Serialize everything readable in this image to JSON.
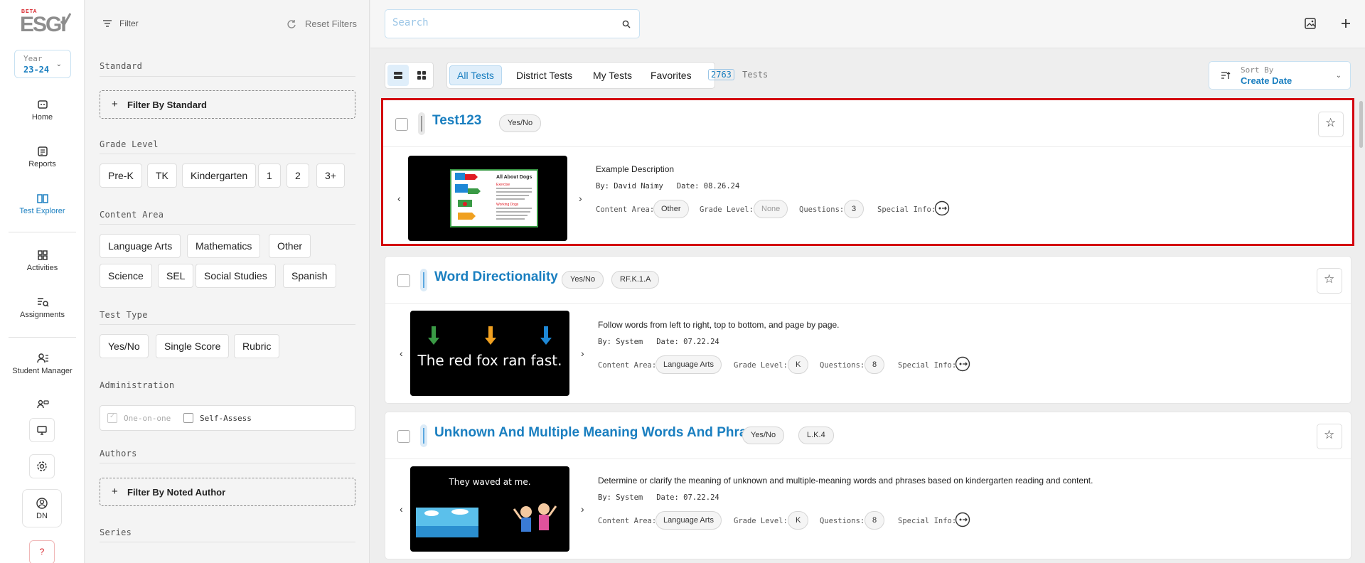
{
  "nav": {
    "logo_beta": "BETA",
    "logo_text": "ESGI",
    "year_label": "Year",
    "year_value": "23-24",
    "items": [
      {
        "label": "Home"
      },
      {
        "label": "Reports"
      },
      {
        "label": "Test Explorer"
      },
      {
        "label": "Activities"
      },
      {
        "label": "Assignments"
      },
      {
        "label": "Student Manager"
      }
    ],
    "user_initials": "DN",
    "help": "?"
  },
  "filters": {
    "filter_label": "Filter",
    "reset_label": "Reset Filters",
    "standard_title": "Standard",
    "standard_button": "Filter By Standard",
    "grade_title": "Grade Level",
    "grades": [
      "Pre-K",
      "TK",
      "Kindergarten",
      "1",
      "2",
      "3+"
    ],
    "content_title": "Content Area",
    "content_areas": [
      "Language Arts",
      "Mathematics",
      "Other",
      "Science",
      "SEL",
      "Social Studies",
      "Spanish"
    ],
    "type_title": "Test Type",
    "types": [
      "Yes/No",
      "Single Score",
      "Rubric"
    ],
    "admin_title": "Administration",
    "admin_options": [
      "One-on-one",
      "Self-Assess"
    ],
    "authors_title": "Authors",
    "authors_button": "Filter By Noted Author",
    "series_title": "Series"
  },
  "main": {
    "search_placeholder": "Search",
    "tabs": [
      "All Tests",
      "District Tests",
      "My Tests",
      "Favorites"
    ],
    "count_value": "2763",
    "count_label": "Tests",
    "sort_label": "Sort By",
    "sort_value": "Create Date",
    "labels": {
      "by": "By:",
      "date": "Date:",
      "content_area": "Content Area:",
      "grade_level": "Grade Level:",
      "questions": "Questions:",
      "special_info": "Special Info:"
    },
    "tests": [
      {
        "title": "Test123",
        "type": "Yes/No",
        "standard": "",
        "description": "Example Description",
        "author": "David Naimy",
        "date": "08.26.24",
        "content_area": "Other",
        "grade_level": "None",
        "questions": "3",
        "thumb_heading": "All About Dogs",
        "thumb_sub1": "Exercise",
        "thumb_sub2": "Working Dogs"
      },
      {
        "title": "Word Directionality",
        "type": "Yes/No",
        "standard": "RF.K.1.A",
        "description": "Follow words from left to right, top to bottom, and page by page.",
        "author": "System",
        "date": "07.22.24",
        "content_area": "Language Arts",
        "grade_level": "K",
        "questions": "8",
        "thumb_text": "The red fox ran fast."
      },
      {
        "title": "Unknown And Multiple Meaning Words And Phrases",
        "type": "Yes/No",
        "standard": "L.K.4",
        "description": "Determine or clarify the meaning of unknown and multiple-meaning words and phrases based on kindergarten reading and content.",
        "author": "System",
        "date": "07.22.24",
        "content_area": "Language Arts",
        "grade_level": "K",
        "questions": "8",
        "thumb_text": "They waved at me."
      }
    ]
  },
  "colors": {
    "accent": "#1a7fc0",
    "selection_border": "#d3000e",
    "help": "#d61f26"
  },
  "icons": [
    "filter-icon",
    "reset-icon",
    "search-icon",
    "image-icon",
    "plus-icon",
    "list-view-icon",
    "grid-view-icon",
    "sort-icon",
    "star-icon",
    "chevron-left-icon",
    "chevron-right-icon",
    "special-info-icon",
    "home-icon",
    "reports-icon",
    "book-icon",
    "activities-icon",
    "assignments-icon",
    "student-manager-icon",
    "monitor-icon",
    "gear-icon",
    "user-icon"
  ]
}
